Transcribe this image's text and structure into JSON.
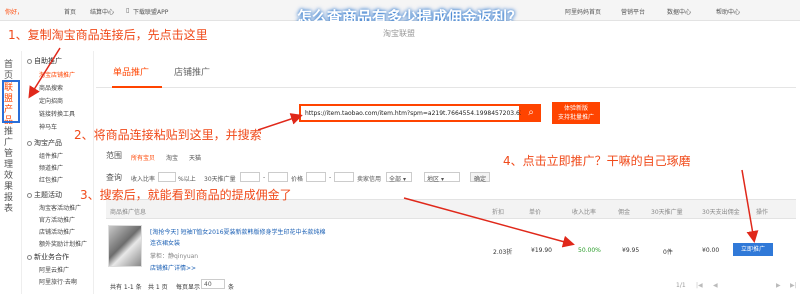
{
  "topbar": {
    "user": "你好，",
    "links": [
      "首页",
      "结算中心",
      "下载联盟APP",
      "阿里妈妈首页",
      "营销平台",
      "数据中心",
      "帮助中心"
    ]
  },
  "headline": "怎么查商品有多少提成佣金返利？",
  "header": {
    "logo_text": "淘宝联盟"
  },
  "leftnav": {
    "home": "首页",
    "alliance": "联盟产品",
    "promo_mgmt": "推广管理",
    "report": "效果报表"
  },
  "menu": {
    "self_promo": "自助推广",
    "items": [
      "淘宝店铺推广",
      "商品搜索",
      "定向招商",
      "链接转换工具",
      "神马车"
    ],
    "taobao_product": "淘宝产品",
    "taobao_items": [
      "组件推广",
      "频道推广",
      "红包推广"
    ],
    "themes": "主题活动",
    "theme_items": [
      "淘宝客活动推广",
      "官方活动推广",
      "店铺活动推广",
      "额外奖励计划推广"
    ],
    "new_biz": "新业务合作",
    "new_items": [
      "阿里云推广",
      "阿里旅行·去啊"
    ]
  },
  "tabs": [
    "单品推广",
    "店铺推广"
  ],
  "search": {
    "value": "https://item.taobao.com/item.htm?spm=a219t.7664554.1998457203.63.",
    "button_icon": "search-icon"
  },
  "new_button": {
    "line1": "体验新版",
    "line2": "支持批量推广"
  },
  "filters": {
    "range_label": "范围",
    "range_all": "所有宝贝",
    "range_taobao": "淘宝",
    "range_tmall": "天猫",
    "query_label": "查询",
    "income_ratio": "收入比率",
    "percent_above": "%以上",
    "promo_volume": "30天推广量",
    "price": "价格",
    "dash": "-",
    "seller_credit": "卖家信用",
    "credit_select": "全部",
    "region_select": "地区",
    "confirm": "确定"
  },
  "table": {
    "headers": [
      "商品推广信息",
      "折扣",
      "单价",
      "收入比率",
      "佣金",
      "30天推广量",
      "30天支出佣金",
      "操作"
    ],
    "row": {
      "title": "[淘抢今天] 短袖T恤女2016夏装新款韩版修身学生印花中长款纯棉",
      "title_line2": "连衣裙女装",
      "seller": "掌柜：静qinyuan",
      "shop_link": "店铺推广详情>>",
      "discount": "2.03折",
      "price": "¥19.90",
      "ratio": "50.00%",
      "commission": "¥9.95",
      "volume": "0件",
      "spent": "¥0.00",
      "action": "立即推广"
    }
  },
  "pager": {
    "summary": "共有 1-1 条",
    "pages": "共 1 页",
    "per_page_label": "每页显示",
    "per_page": "40",
    "unit": "条",
    "current": "1/1"
  },
  "annotations": {
    "a1": "1、复制淘宝商品连接后，先点击这里",
    "a2": "2、将商品连接粘贴到这里，并搜索",
    "a3": "3、搜索后，就能看到商品的提成佣金了",
    "a4": "4、点击立即推广？干嘛的自己琢磨"
  }
}
